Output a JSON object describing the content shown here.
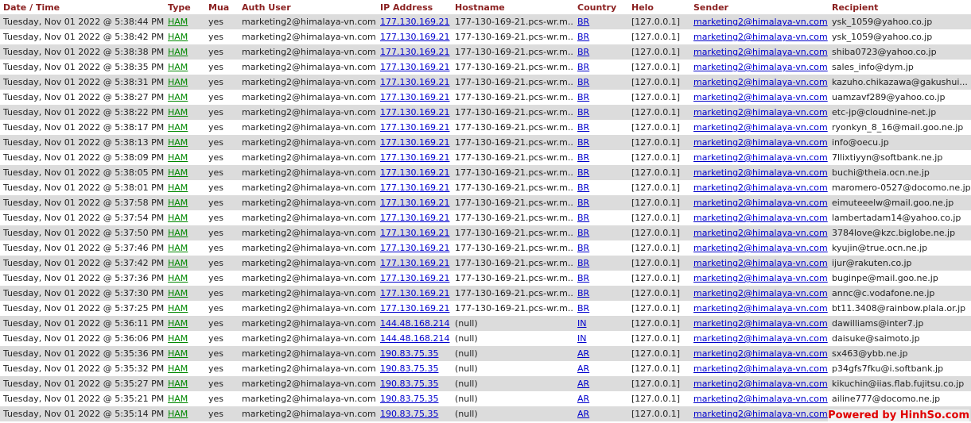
{
  "columns": [
    "Date / Time",
    "Type",
    "Mua",
    "Auth User",
    "IP Address",
    "Hostname",
    "Country",
    "Helo",
    "Sender",
    "Recipient"
  ],
  "colors": {
    "header": "#8a1f1f",
    "link": "#0000cc",
    "ham": "#008800",
    "row_alt": "#dcdcdc",
    "watermark": "#e00000"
  },
  "rows": [
    {
      "datetime": "Tuesday, Nov 01 2022 @ 5:38:44 PM",
      "type": "HAM",
      "mua": "yes",
      "auth_user": "marketing2@himalaya-vn.com",
      "ip": "177.130.169.21",
      "hostname": "177-130-169-21.pcs-wr.m...",
      "country": "BR",
      "helo": "[127.0.0.1]",
      "sender": "marketing2@himalaya-vn.com",
      "recipient": "ysk_1059@yahoo.co.jp"
    },
    {
      "datetime": "Tuesday, Nov 01 2022 @ 5:38:42 PM",
      "type": "HAM",
      "mua": "yes",
      "auth_user": "marketing2@himalaya-vn.com",
      "ip": "177.130.169.21",
      "hostname": "177-130-169-21.pcs-wr.m...",
      "country": "BR",
      "helo": "[127.0.0.1]",
      "sender": "marketing2@himalaya-vn.com",
      "recipient": "ysk_1059@yahoo.co.jp"
    },
    {
      "datetime": "Tuesday, Nov 01 2022 @ 5:38:38 PM",
      "type": "HAM",
      "mua": "yes",
      "auth_user": "marketing2@himalaya-vn.com",
      "ip": "177.130.169.21",
      "hostname": "177-130-169-21.pcs-wr.m...",
      "country": "BR",
      "helo": "[127.0.0.1]",
      "sender": "marketing2@himalaya-vn.com",
      "recipient": "shiba0723@yahoo.co.jp"
    },
    {
      "datetime": "Tuesday, Nov 01 2022 @ 5:38:35 PM",
      "type": "HAM",
      "mua": "yes",
      "auth_user": "marketing2@himalaya-vn.com",
      "ip": "177.130.169.21",
      "hostname": "177-130-169-21.pcs-wr.m...",
      "country": "BR",
      "helo": "[127.0.0.1]",
      "sender": "marketing2@himalaya-vn.com",
      "recipient": "sales_info@dym.jp"
    },
    {
      "datetime": "Tuesday, Nov 01 2022 @ 5:38:31 PM",
      "type": "HAM",
      "mua": "yes",
      "auth_user": "marketing2@himalaya-vn.com",
      "ip": "177.130.169.21",
      "hostname": "177-130-169-21.pcs-wr.m...",
      "country": "BR",
      "helo": "[127.0.0.1]",
      "sender": "marketing2@himalaya-vn.com",
      "recipient": "kazuho.chikazawa@gakushui..."
    },
    {
      "datetime": "Tuesday, Nov 01 2022 @ 5:38:27 PM",
      "type": "HAM",
      "mua": "yes",
      "auth_user": "marketing2@himalaya-vn.com",
      "ip": "177.130.169.21",
      "hostname": "177-130-169-21.pcs-wr.m...",
      "country": "BR",
      "helo": "[127.0.0.1]",
      "sender": "marketing2@himalaya-vn.com",
      "recipient": "uamzavf289@yahoo.co.jp"
    },
    {
      "datetime": "Tuesday, Nov 01 2022 @ 5:38:22 PM",
      "type": "HAM",
      "mua": "yes",
      "auth_user": "marketing2@himalaya-vn.com",
      "ip": "177.130.169.21",
      "hostname": "177-130-169-21.pcs-wr.m...",
      "country": "BR",
      "helo": "[127.0.0.1]",
      "sender": "marketing2@himalaya-vn.com",
      "recipient": "etc-jp@cloudnine-net.jp"
    },
    {
      "datetime": "Tuesday, Nov 01 2022 @ 5:38:17 PM",
      "type": "HAM",
      "mua": "yes",
      "auth_user": "marketing2@himalaya-vn.com",
      "ip": "177.130.169.21",
      "hostname": "177-130-169-21.pcs-wr.m...",
      "country": "BR",
      "helo": "[127.0.0.1]",
      "sender": "marketing2@himalaya-vn.com",
      "recipient": "ryonkyn_8_16@mail.goo.ne.jp"
    },
    {
      "datetime": "Tuesday, Nov 01 2022 @ 5:38:13 PM",
      "type": "HAM",
      "mua": "yes",
      "auth_user": "marketing2@himalaya-vn.com",
      "ip": "177.130.169.21",
      "hostname": "177-130-169-21.pcs-wr.m...",
      "country": "BR",
      "helo": "[127.0.0.1]",
      "sender": "marketing2@himalaya-vn.com",
      "recipient": "info@oecu.jp"
    },
    {
      "datetime": "Tuesday, Nov 01 2022 @ 5:38:09 PM",
      "type": "HAM",
      "mua": "yes",
      "auth_user": "marketing2@himalaya-vn.com",
      "ip": "177.130.169.21",
      "hostname": "177-130-169-21.pcs-wr.m...",
      "country": "BR",
      "helo": "[127.0.0.1]",
      "sender": "marketing2@himalaya-vn.com",
      "recipient": "7llixtiyyn@softbank.ne.jp"
    },
    {
      "datetime": "Tuesday, Nov 01 2022 @ 5:38:05 PM",
      "type": "HAM",
      "mua": "yes",
      "auth_user": "marketing2@himalaya-vn.com",
      "ip": "177.130.169.21",
      "hostname": "177-130-169-21.pcs-wr.m...",
      "country": "BR",
      "helo": "[127.0.0.1]",
      "sender": "marketing2@himalaya-vn.com",
      "recipient": "buchi@theia.ocn.ne.jp"
    },
    {
      "datetime": "Tuesday, Nov 01 2022 @ 5:38:01 PM",
      "type": "HAM",
      "mua": "yes",
      "auth_user": "marketing2@himalaya-vn.com",
      "ip": "177.130.169.21",
      "hostname": "177-130-169-21.pcs-wr.m...",
      "country": "BR",
      "helo": "[127.0.0.1]",
      "sender": "marketing2@himalaya-vn.com",
      "recipient": "maromero-0527@docomo.ne.jp"
    },
    {
      "datetime": "Tuesday, Nov 01 2022 @ 5:37:58 PM",
      "type": "HAM",
      "mua": "yes",
      "auth_user": "marketing2@himalaya-vn.com",
      "ip": "177.130.169.21",
      "hostname": "177-130-169-21.pcs-wr.m...",
      "country": "BR",
      "helo": "[127.0.0.1]",
      "sender": "marketing2@himalaya-vn.com",
      "recipient": "eimuteeelw@mail.goo.ne.jp"
    },
    {
      "datetime": "Tuesday, Nov 01 2022 @ 5:37:54 PM",
      "type": "HAM",
      "mua": "yes",
      "auth_user": "marketing2@himalaya-vn.com",
      "ip": "177.130.169.21",
      "hostname": "177-130-169-21.pcs-wr.m...",
      "country": "BR",
      "helo": "[127.0.0.1]",
      "sender": "marketing2@himalaya-vn.com",
      "recipient": "lambertadam14@yahoo.co.jp"
    },
    {
      "datetime": "Tuesday, Nov 01 2022 @ 5:37:50 PM",
      "type": "HAM",
      "mua": "yes",
      "auth_user": "marketing2@himalaya-vn.com",
      "ip": "177.130.169.21",
      "hostname": "177-130-169-21.pcs-wr.m...",
      "country": "BR",
      "helo": "[127.0.0.1]",
      "sender": "marketing2@himalaya-vn.com",
      "recipient": "3784love@kzc.biglobe.ne.jp"
    },
    {
      "datetime": "Tuesday, Nov 01 2022 @ 5:37:46 PM",
      "type": "HAM",
      "mua": "yes",
      "auth_user": "marketing2@himalaya-vn.com",
      "ip": "177.130.169.21",
      "hostname": "177-130-169-21.pcs-wr.m...",
      "country": "BR",
      "helo": "[127.0.0.1]",
      "sender": "marketing2@himalaya-vn.com",
      "recipient": "kyujin@true.ocn.ne.jp"
    },
    {
      "datetime": "Tuesday, Nov 01 2022 @ 5:37:42 PM",
      "type": "HAM",
      "mua": "yes",
      "auth_user": "marketing2@himalaya-vn.com",
      "ip": "177.130.169.21",
      "hostname": "177-130-169-21.pcs-wr.m...",
      "country": "BR",
      "helo": "[127.0.0.1]",
      "sender": "marketing2@himalaya-vn.com",
      "recipient": "ijur@rakuten.co.jp"
    },
    {
      "datetime": "Tuesday, Nov 01 2022 @ 5:37:36 PM",
      "type": "HAM",
      "mua": "yes",
      "auth_user": "marketing2@himalaya-vn.com",
      "ip": "177.130.169.21",
      "hostname": "177-130-169-21.pcs-wr.m...",
      "country": "BR",
      "helo": "[127.0.0.1]",
      "sender": "marketing2@himalaya-vn.com",
      "recipient": "buginpe@mail.goo.ne.jp"
    },
    {
      "datetime": "Tuesday, Nov 01 2022 @ 5:37:30 PM",
      "type": "HAM",
      "mua": "yes",
      "auth_user": "marketing2@himalaya-vn.com",
      "ip": "177.130.169.21",
      "hostname": "177-130-169-21.pcs-wr.m...",
      "country": "BR",
      "helo": "[127.0.0.1]",
      "sender": "marketing2@himalaya-vn.com",
      "recipient": "annc@c.vodafone.ne.jp"
    },
    {
      "datetime": "Tuesday, Nov 01 2022 @ 5:37:25 PM",
      "type": "HAM",
      "mua": "yes",
      "auth_user": "marketing2@himalaya-vn.com",
      "ip": "177.130.169.21",
      "hostname": "177-130-169-21.pcs-wr.m...",
      "country": "BR",
      "helo": "[127.0.0.1]",
      "sender": "marketing2@himalaya-vn.com",
      "recipient": "bt11.3408@rainbow.plala.or.jp"
    },
    {
      "datetime": "Tuesday, Nov 01 2022 @ 5:36:11 PM",
      "type": "HAM",
      "mua": "yes",
      "auth_user": "marketing2@himalaya-vn.com",
      "ip": "144.48.168.214",
      "hostname": "(null)",
      "country": "IN",
      "helo": "[127.0.0.1]",
      "sender": "marketing2@himalaya-vn.com",
      "recipient": "dawilliams@inter7.jp"
    },
    {
      "datetime": "Tuesday, Nov 01 2022 @ 5:36:06 PM",
      "type": "HAM",
      "mua": "yes",
      "auth_user": "marketing2@himalaya-vn.com",
      "ip": "144.48.168.214",
      "hostname": "(null)",
      "country": "IN",
      "helo": "[127.0.0.1]",
      "sender": "marketing2@himalaya-vn.com",
      "recipient": "daisuke@saimoto.jp"
    },
    {
      "datetime": "Tuesday, Nov 01 2022 @ 5:35:36 PM",
      "type": "HAM",
      "mua": "yes",
      "auth_user": "marketing2@himalaya-vn.com",
      "ip": "190.83.75.35",
      "hostname": "(null)",
      "country": "AR",
      "helo": "[127.0.0.1]",
      "sender": "marketing2@himalaya-vn.com",
      "recipient": "sx463@ybb.ne.jp"
    },
    {
      "datetime": "Tuesday, Nov 01 2022 @ 5:35:32 PM",
      "type": "HAM",
      "mua": "yes",
      "auth_user": "marketing2@himalaya-vn.com",
      "ip": "190.83.75.35",
      "hostname": "(null)",
      "country": "AR",
      "helo": "[127.0.0.1]",
      "sender": "marketing2@himalaya-vn.com",
      "recipient": "p34gfs7fku@i.softbank.jp"
    },
    {
      "datetime": "Tuesday, Nov 01 2022 @ 5:35:27 PM",
      "type": "HAM",
      "mua": "yes",
      "auth_user": "marketing2@himalaya-vn.com",
      "ip": "190.83.75.35",
      "hostname": "(null)",
      "country": "AR",
      "helo": "[127.0.0.1]",
      "sender": "marketing2@himalaya-vn.com",
      "recipient": "kikuchin@iias.flab.fujitsu.co.jp"
    },
    {
      "datetime": "Tuesday, Nov 01 2022 @ 5:35:21 PM",
      "type": "HAM",
      "mua": "yes",
      "auth_user": "marketing2@himalaya-vn.com",
      "ip": "190.83.75.35",
      "hostname": "(null)",
      "country": "AR",
      "helo": "[127.0.0.1]",
      "sender": "marketing2@himalaya-vn.com",
      "recipient": "ailine777@docomo.ne.jp"
    },
    {
      "datetime": "Tuesday, Nov 01 2022 @ 5:35:14 PM",
      "type": "HAM",
      "mua": "yes",
      "auth_user": "marketing2@himalaya-vn.com",
      "ip": "190.83.75.35",
      "hostname": "(null)",
      "country": "AR",
      "helo": "[127.0.0.1]",
      "sender": "marketing2@himalaya-vn.com",
      "recipient": ""
    }
  ],
  "watermark": "Powered by HinhSo.com"
}
